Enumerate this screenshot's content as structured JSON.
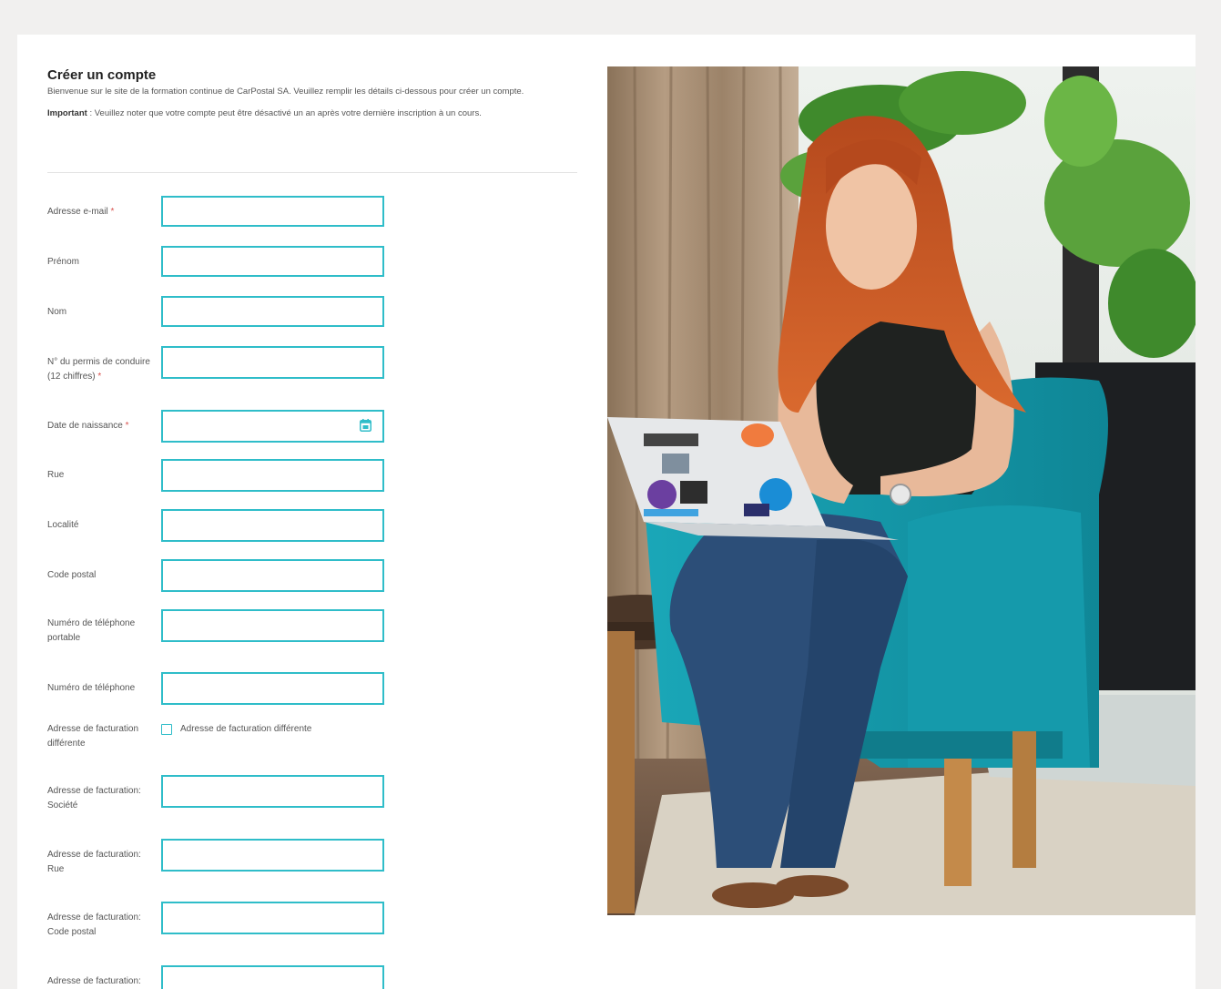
{
  "form": {
    "title": "Créer un compte",
    "intro": "Bienvenue sur le site de la formation continue de CarPostal SA. Veuillez remplir les détails ci-dessous pour créer un compte.",
    "important_label": "Important",
    "important_text": " : Veuillez noter que votre compte peut être désactivé un an après votre dernière inscription à un cours.",
    "fields": {
      "email": {
        "label": "Adresse e-mail",
        "required": "*"
      },
      "firstname": {
        "label": "Prénom"
      },
      "lastname": {
        "label": "Nom"
      },
      "license": {
        "label": "N° du permis de conduire (12 chiffres)",
        "required": "*"
      },
      "birthdate": {
        "label": "Date de naissance",
        "required": "*"
      },
      "street": {
        "label": "Rue"
      },
      "city": {
        "label": "Localité"
      },
      "zip": {
        "label": "Code postal"
      },
      "mobile": {
        "label": "Numéro de téléphone portable"
      },
      "phone": {
        "label": "Numéro de téléphone"
      },
      "billing_diff": {
        "label": "Adresse de facturation différente",
        "checkbox_label": "Adresse de facturation différente"
      },
      "billing_company": {
        "label": "Adresse de facturation: Société"
      },
      "billing_street": {
        "label": "Adresse de facturation: Rue"
      },
      "billing_zip": {
        "label": "Adresse de facturation: Code postal"
      },
      "billing_city": {
        "label": "Adresse de facturation:"
      }
    }
  },
  "colors": {
    "accent": "#2fbdc9",
    "required": "#d9534f",
    "page_bg": "#f1f0ef"
  },
  "icons": {
    "date": "calendar-icon"
  },
  "photo": {
    "description_icon": "photo-woman-laptop"
  }
}
